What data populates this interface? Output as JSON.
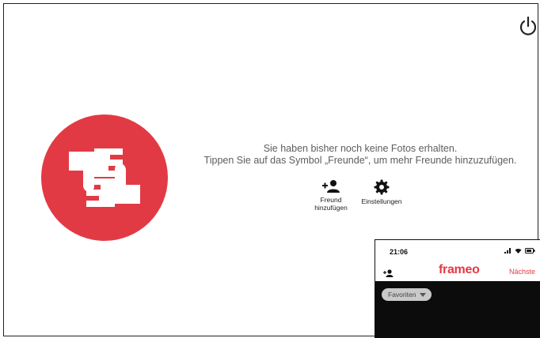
{
  "message": {
    "line1": "Sie haben bisher noch keine Fotos erhalten.",
    "line2": "Tippen Sie auf das Symbol „Freunde“, um mehr Freunde hinzuzufügen."
  },
  "actions": [
    {
      "label_line1": "Freund",
      "label_line2": "hinzufügen",
      "icon": "add-person-icon"
    },
    {
      "label": "Einstellungen",
      "icon": "gear-icon"
    }
  ],
  "phone": {
    "time": "21:06",
    "brand": "frameo",
    "next_label": "Nächste",
    "filter_label": "Favoriten"
  },
  "colors": {
    "brand_red": "#e23a44",
    "text_gray": "#5d5d5d"
  }
}
